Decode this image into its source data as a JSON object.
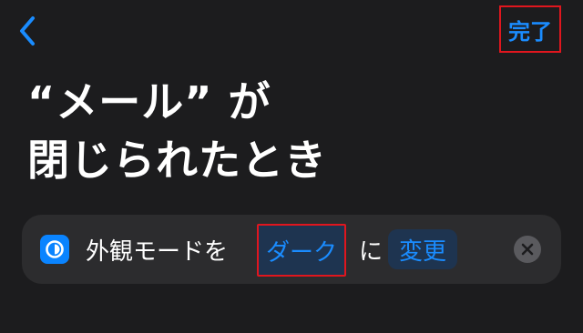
{
  "header": {
    "back_icon": "chevron-left-icon",
    "done_label": "完了"
  },
  "title": {
    "line1": "“メール” が",
    "line2": "閉じられたとき"
  },
  "action": {
    "app_icon": "appearance-icon",
    "prefix": "外観モードを",
    "mode_value": "ダーク",
    "connector": "に",
    "operation_value": "変更",
    "clear_icon": "clear-x-icon"
  },
  "colors": {
    "background": "#1c1c1e",
    "card": "#2c2c2e",
    "accent": "#1a8cff",
    "highlight_border": "#e0161e"
  }
}
